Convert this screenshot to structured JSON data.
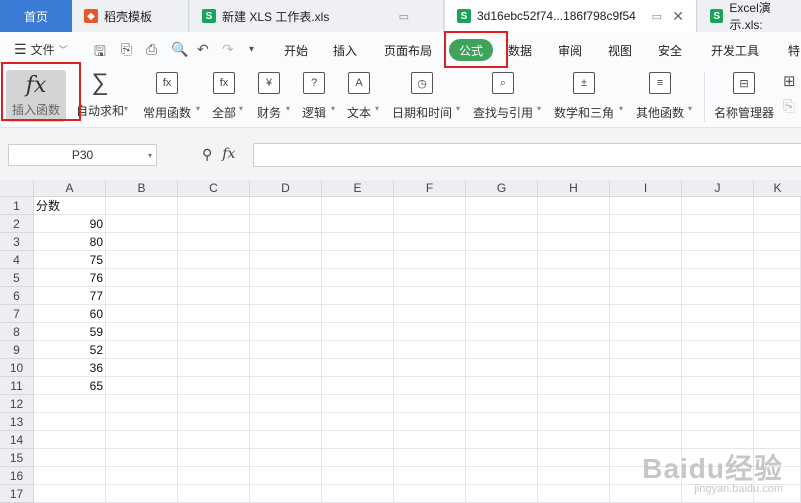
{
  "tabs": {
    "home": "首页",
    "t1": "稻壳模板",
    "t2": "新建 XLS 工作表.xls",
    "t3": "3d16ebc52f74...186f798c9f54",
    "t4": "Excel演示.xls:"
  },
  "menu": {
    "file": "文件",
    "items": [
      "开始",
      "插入",
      "页面布局",
      "公式",
      "数据",
      "审阅",
      "视图",
      "安全",
      "开发工具",
      "特"
    ],
    "active": "公式"
  },
  "ribbon": {
    "insert_function": "插入函数",
    "autosum": "自动求和",
    "common": "常用函数",
    "all": "全部",
    "finance": "财务",
    "logic": "逻辑",
    "text": "文本",
    "datetime": "日期和时间",
    "lookup": "查找与引用",
    "math": "数学和三角",
    "other": "其他函数",
    "name_manager": "名称管理器"
  },
  "formula_bar": {
    "name_box": "P30",
    "fx": "fx",
    "value": ""
  },
  "sheet": {
    "columns": [
      "A",
      "B",
      "C",
      "D",
      "E",
      "F",
      "G",
      "H",
      "I",
      "J",
      "K"
    ],
    "rows": [
      "1",
      "2",
      "3",
      "4",
      "5",
      "6",
      "7",
      "8",
      "9",
      "10",
      "11",
      "12",
      "13",
      "14",
      "15",
      "16",
      "17"
    ],
    "header": "分数",
    "values": [
      "90",
      "80",
      "75",
      "76",
      "77",
      "60",
      "59",
      "52",
      "36",
      "65"
    ]
  },
  "watermark": {
    "brand": "Baidu经验",
    "url": "jingyan.baidu.com"
  },
  "colors": {
    "accent": "#3fa35b",
    "home_tab": "#3a7bd5",
    "highlight": "#e02020"
  }
}
